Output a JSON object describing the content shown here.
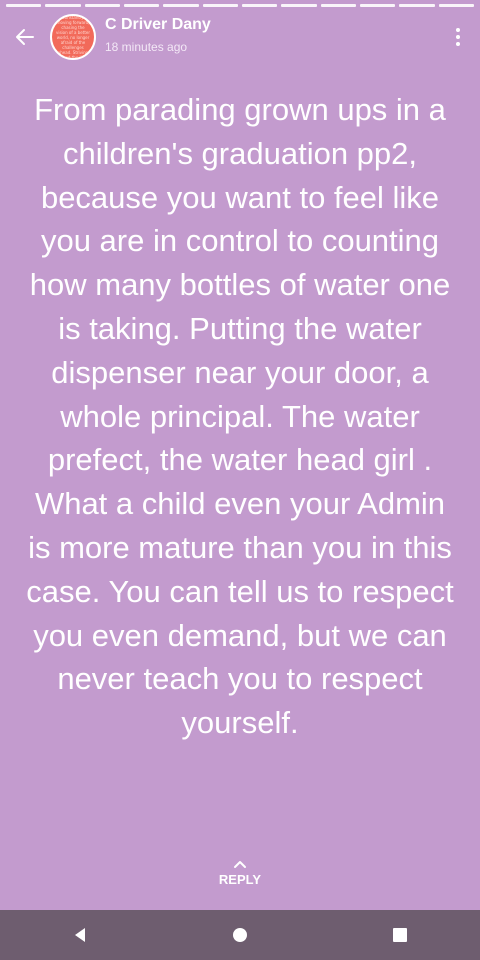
{
  "status": {
    "author": "C Driver Dany",
    "time_ago": "18 minutes ago",
    "avatar_text": "the one constantly moving forward, chasing the vision of a better world, no longer afraid of the challenges ahead. Striving beyond the limits to uplift all",
    "text": "From parading grown ups in a children's graduation pp2, because you want to feel like you are in control to counting how many bottles of water one is taking. Putting the water dispenser near your door, a whole principal. The water prefect, the water head girl . What a child even your Admin is more mature than you in this case. You can tell us to respect you even demand, but we can never teach you to respect yourself."
  },
  "reply": {
    "label": "REPLY"
  },
  "colors": {
    "background": "#c39bce",
    "navbar": "#6e5d6f",
    "avatar": "#f26a5a"
  },
  "icons": {
    "back": "arrow-left-icon",
    "menu": "more-vertical-icon",
    "reply": "chevron-up-icon",
    "nav_back": "triangle-back-icon",
    "nav_home": "circle-home-icon",
    "nav_recents": "square-recents-icon"
  }
}
